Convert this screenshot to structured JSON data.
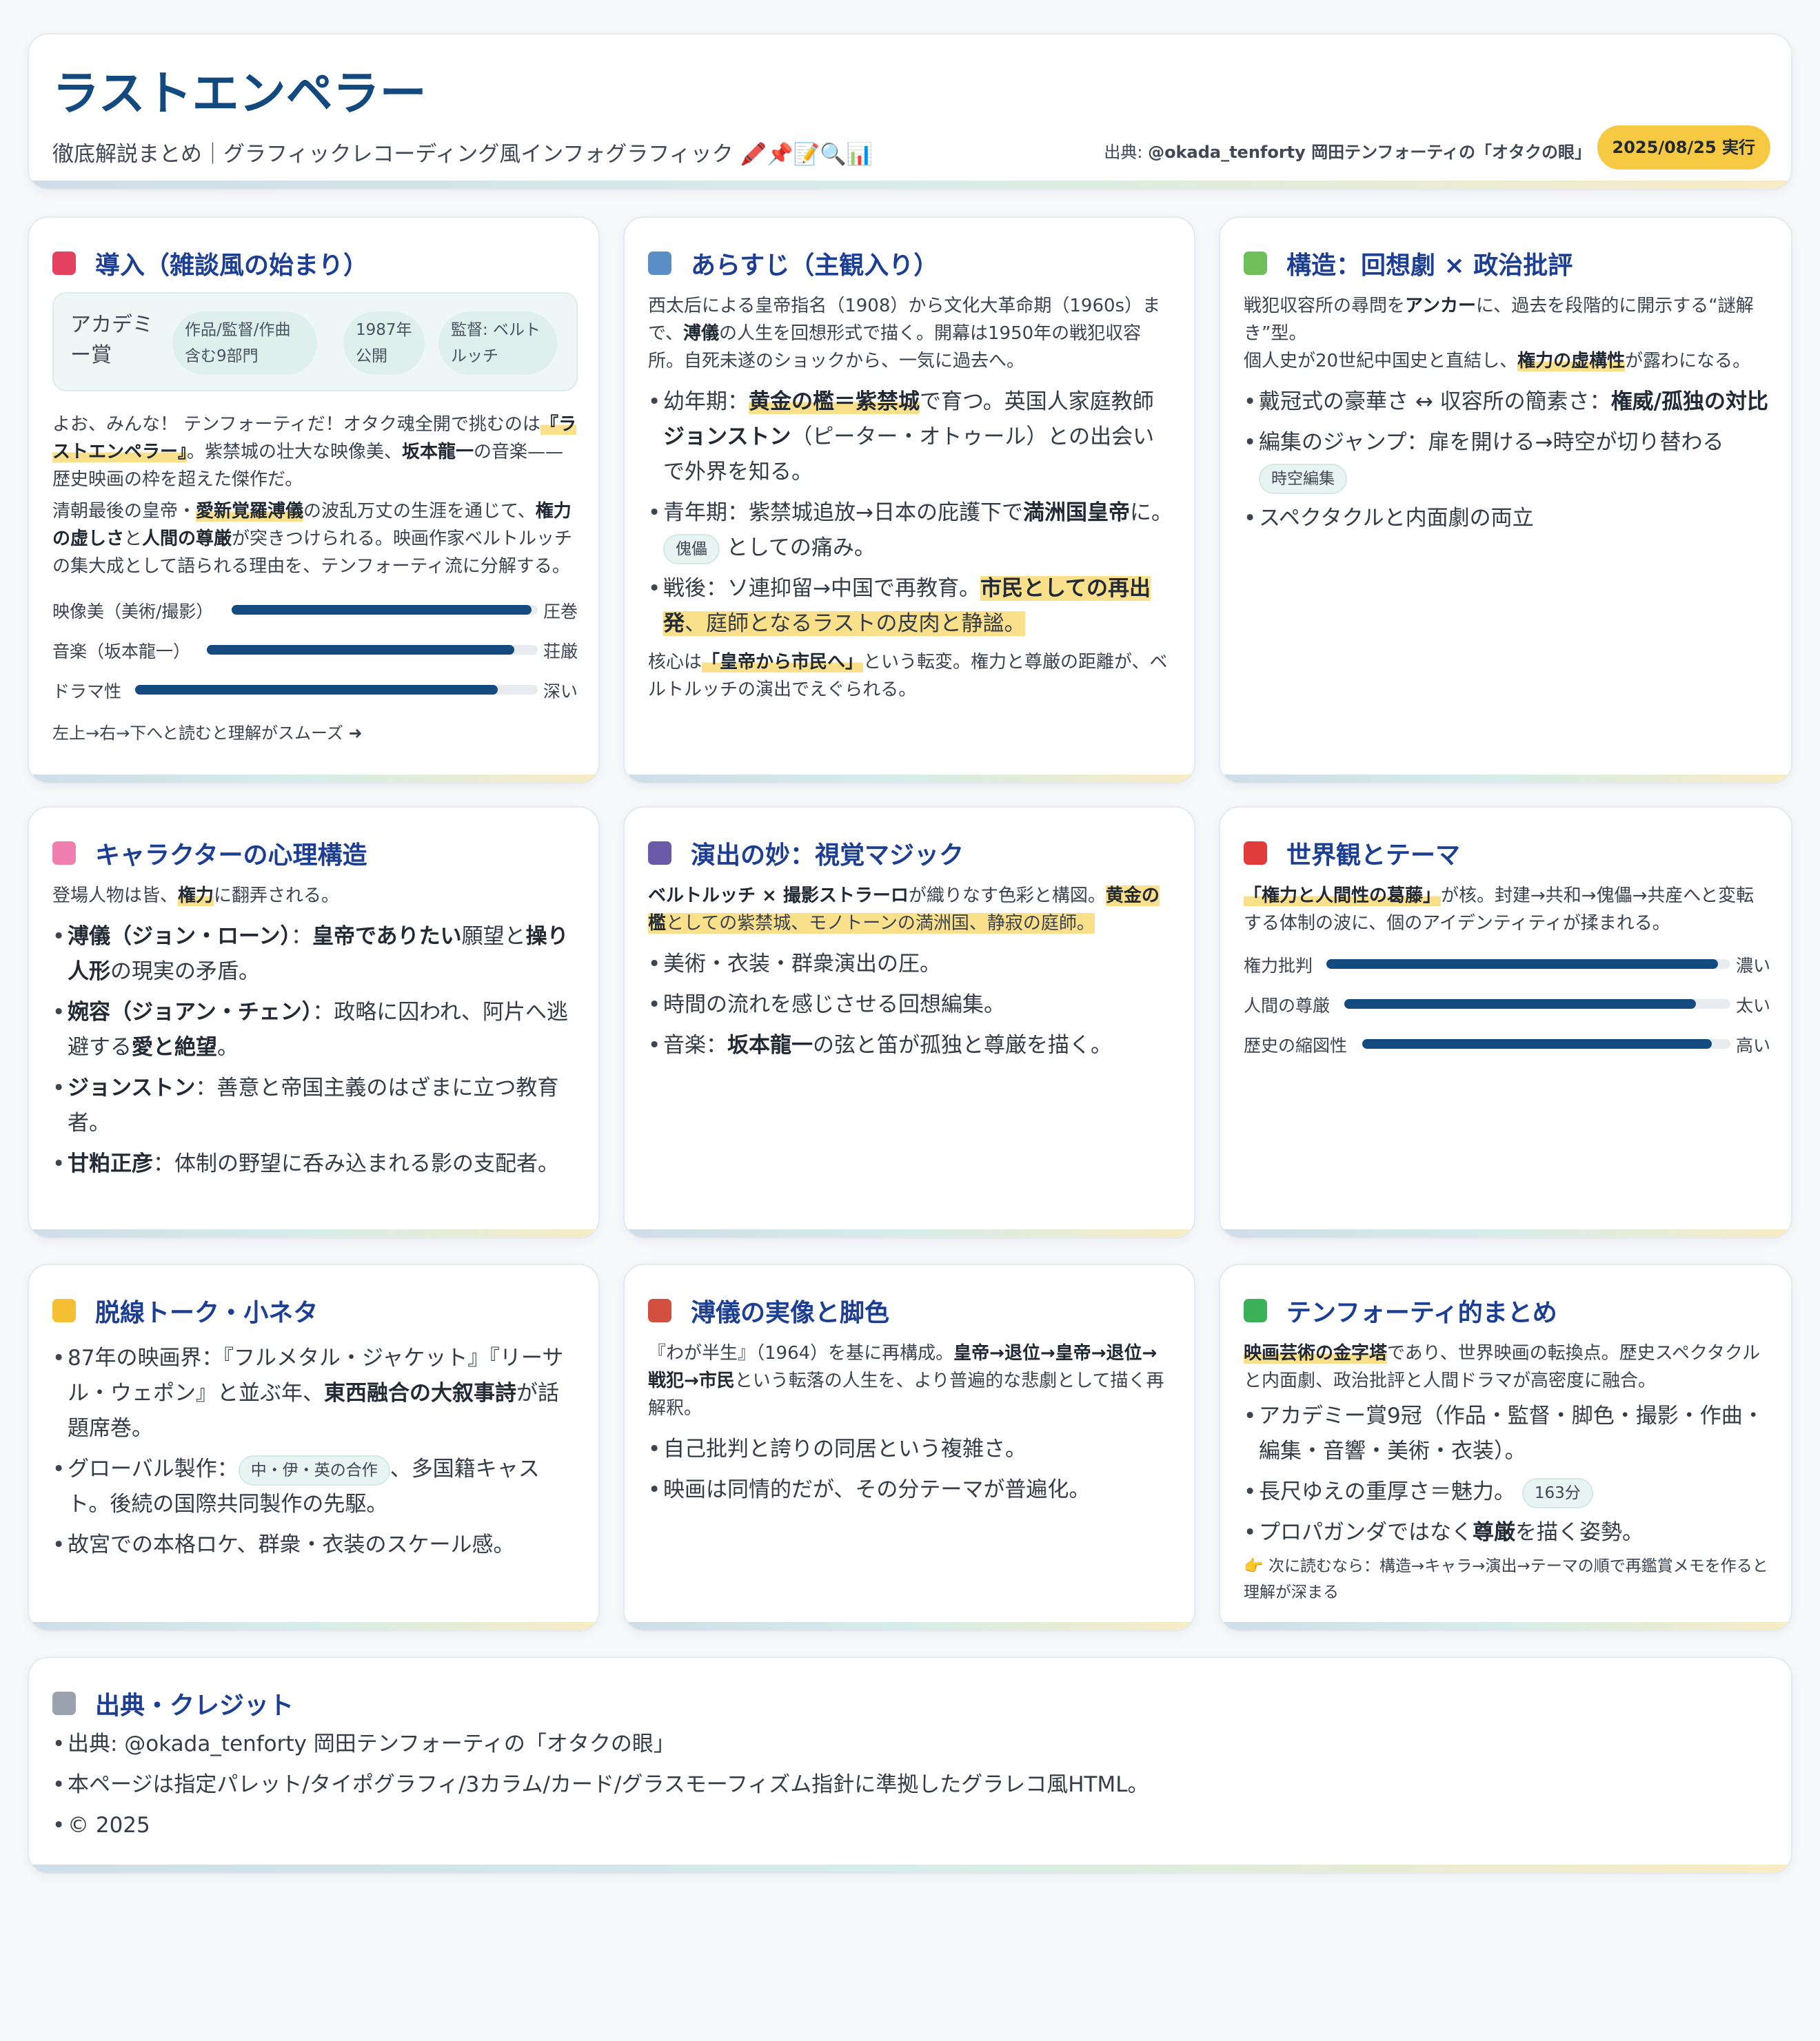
{
  "header": {
    "title": "ラストエンペラー",
    "subtitle": "徹底解説まとめ｜グラフィックレコーディング風インフォグラフィック 🖍️📌📝🔍📊",
    "source_prefix": "出典: ",
    "source_name": "@okada_tenforty 岡田テンフォーティの「オタクの眼」",
    "badge": "2025/08/25 実行"
  },
  "intro": {
    "title": "導入（雑談風の始まり）",
    "icon_color": "#e4405f",
    "award": "アカデミー賞",
    "chip1": "作品/監督/作曲含む9部門",
    "chip2": "1987年公開",
    "chip3": "監督: ベルトルッチ",
    "p1_a": "よお、みんな！ テンフォーティだ！オタク魂全開で挑むのは",
    "p1_hl": "『ラストエンペラー』",
    "p1_b": "。紫禁城の壮大な映像美、",
    "p1_bold": "坂本龍一",
    "p1_c": "の音楽——歴史映画の枠を超えた傑作だ。",
    "p2_a": "清朝最後の皇帝・",
    "p2_hl": "愛新覚羅溥儀",
    "p2_b": "の波乱万丈の生涯を通じて、",
    "p2_bold1": "権力の虚しさ",
    "p2_c": "と",
    "p2_bold2": "人間の尊厳",
    "p2_d": "が突きつけられる。映画作家ベルトルッチの集大成として語られる理由を、テンフォーティ流に分解する。",
    "bars": [
      {
        "label": "映像美（美術/撮影）",
        "value": 0.98,
        "tag": "圧巻"
      },
      {
        "label": "音楽（坂本龍一）",
        "value": 0.93,
        "tag": "荘厳"
      },
      {
        "label": "ドラマ性",
        "value": 0.9,
        "tag": "深い"
      }
    ],
    "note": "左上→右→下へと読むと理解がスムーズ ➜"
  },
  "synopsis": {
    "title": "あらすじ（主観入り）",
    "icon_color": "#5b8ec6",
    "p1_a": "西太后による皇帝指名（1908）から文化大革命期（1960s）まで、",
    "p1_bold": "溥儀",
    "p1_b": "の人生を回想形式で描く。開幕は1950年の戦犯収容所。自死未遂のショックから、一気に過去へ。",
    "li1_a": "幼年期：",
    "li1_hl": "黄金の檻＝紫禁城",
    "li1_b": "で育つ。英国人家庭教師",
    "li1_bold": "ジョンストン",
    "li1_c": "（ピーター・オトゥール）との出会いで外界を知る。",
    "li2_a": "青年期：紫禁城追放→日本の庇護下で",
    "li2_bold": "満洲国皇帝",
    "li2_b": "に。",
    "li2_chip": "傀儡",
    "li2_c": "としての痛み。",
    "li3_a": "戦後：ソ連抑留→中国で再教育。",
    "li3_bold": "市民としての再出発",
    "li3_b": "、庭師となるラストの皮肉と静謐。",
    "p2_a": "核心は",
    "p2_hl": "「皇帝から市民へ」",
    "p2_b": "という転変。権力と尊厳の距離が、ベルトルッチの演出でえぐられる。"
  },
  "structure": {
    "title": "構造：回想劇 × 政治批評",
    "icon_color": "#6fbf5a",
    "p1_a": "戦犯収容所の尋問を",
    "p1_bold": "アンカー",
    "p1_b": "に、過去を段階的に開示する“謎解き”型。",
    "p2_a": "個人史が20世紀中国史と直結し、",
    "p2_hl": "権力の虚構性",
    "p2_b": "が露わになる。",
    "li1_a": "戴冠式の豪華さ ↔ 収容所の簡素さ：",
    "li1_bold": "権威/孤独の対比",
    "li2": "編集のジャンプ：扉を開ける→時空が切り替わる",
    "li2_chip": "時空編集",
    "li3": "スペクタクルと内面劇の両立"
  },
  "characters": {
    "title": "キャラクターの心理構造",
    "icon_color": "#f07fb0",
    "p1_a": "登場人物は皆、",
    "p1_hl": "権力",
    "p1_b": "に翻弄される。",
    "li1_bold1": "溥儀（ジョン・ローン）",
    "li1_a": "：",
    "li1_bold2": "皇帝でありたい",
    "li1_b": "願望と",
    "li1_bold3": "操り人形",
    "li1_c": "の現実の矛盾。",
    "li2_bold1": "婉容（ジョアン・チェン）",
    "li2_a": "：政略に囚われ、阿片へ逃避する",
    "li2_bold2": "愛と絶望",
    "li2_b": "。",
    "li3_bold": "ジョンストン",
    "li3_a": "：善意と帝国主義のはざまに立つ教育者。",
    "li4_bold": "甘粕正彦",
    "li4_a": "：体制の野望に呑み込まれる影の支配者。"
  },
  "direction": {
    "title": "演出の妙：視覚マジック",
    "icon_color": "#6b5aa8",
    "p1_bold1": "ベルトルッチ × 撮影ストラーロ",
    "p1_a": "が織りなす色彩と構図。",
    "p1_hl_bold": "黄金の檻",
    "p1_hl": "としての紫禁城、モノトーンの満洲国、静寂の庭師。",
    "li1": "美術・衣装・群衆演出の圧。",
    "li2": "時間の流れを感じさせる回想編集。",
    "li3_a": "音楽：",
    "li3_bold": "坂本龍一",
    "li3_b": "の弦と笛が孤独と尊厳を描く。"
  },
  "theme": {
    "title": "世界観とテーマ",
    "icon_color": "#e23b3b",
    "p1_hl": "「権力と人間性の葛藤」",
    "p1_a": "が核。封建→共和→傀儡→共産へと変転する体制の波に、個のアイデンティティが揉まれる。",
    "bars": [
      {
        "label": "権力批判",
        "value": 0.97,
        "tag": "濃い"
      },
      {
        "label": "人間の尊厳",
        "value": 0.91,
        "tag": "太い"
      },
      {
        "label": "歴史の縮図性",
        "value": 0.95,
        "tag": "高い"
      }
    ]
  },
  "trivia": {
    "title": "脱線トーク・小ネタ",
    "icon_color": "#f5c033",
    "li1_a": "87年の映画界：『フルメタル・ジャケット』『リーサル・ウェポン』と並ぶ年、",
    "li1_bold": "東西融合の大叙事詩",
    "li1_b": "が話題席巻。",
    "li2_a": "グローバル製作：",
    "li2_chip": "中・伊・英の合作",
    "li2_b": "、多国籍キャスト。後続の国際共同製作の先駆。",
    "li3": "故宮での本格ロケ、群衆・衣装のスケール感。"
  },
  "reality": {
    "title": "溥儀の実像と脚色",
    "icon_color": "#d2503f",
    "p1_a": "『わが半生』（1964）を基に再構成。",
    "p1_bold": "皇帝→退位→皇帝→退位→戦犯→市民",
    "p1_b": "という転落の人生を、より普遍的な悲劇として描く再解釈。",
    "li1": "自己批判と誇りの同居という複雑さ。",
    "li2": "映画は同情的だが、その分テーマが普遍化。"
  },
  "summary": {
    "title": "テンフォーティ的まとめ",
    "icon_color": "#3bb25a",
    "p1_hl": "映画芸術の金字塔",
    "p1_a": "であり、世界映画の転換点。歴史スペクタクルと内面劇、政治批評と人間ドラマが高密度に融合。",
    "li1": "アカデミー賞9冠（作品・監督・脚色・撮影・作曲・編集・音響・美術・衣装）。",
    "li2": "長尺ゆえの重厚さ＝魅力。",
    "li2_chip": "163分",
    "li3_a": "プロパガンダではなく",
    "li3_bold": "尊厳",
    "li3_b": "を描く姿勢。",
    "note": "👉 次に読むなら：構造→キャラ→演出→テーマの順で再鑑賞メモを作ると理解が深まる"
  },
  "credits": {
    "title": "出典・クレジット",
    "icon_color": "#9aa3ad",
    "li1": "出典: @okada_tenforty 岡田テンフォーティの「オタクの眼」",
    "li2": "本ページは指定パレット/タイポグラフィ/3カラム/カード/グラスモーフィズム指針に準拠したグラレコ風HTML。",
    "li3": "© 2025"
  }
}
